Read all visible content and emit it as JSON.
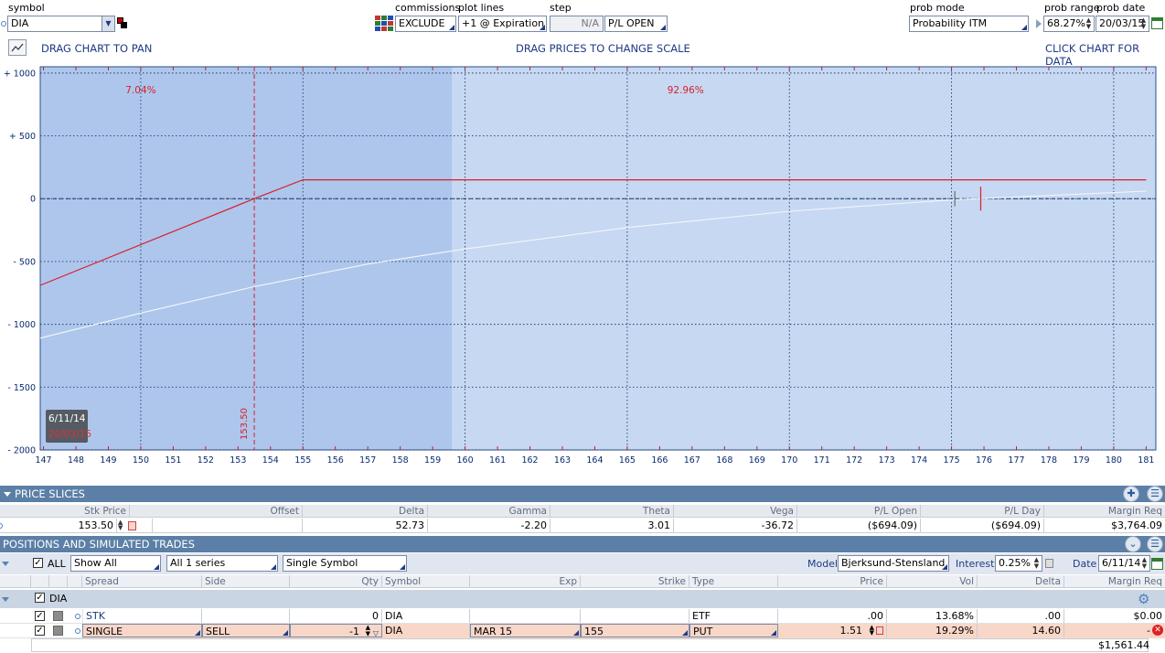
{
  "toolbar": {
    "symbol_label": "symbol",
    "symbol_value": "DIA",
    "commissions_label": "commissions",
    "commissions_value": "EXCLUDE",
    "plot_lines_label": "plot lines",
    "plot_lines_value": "+1 @ Expiration",
    "step_label": "step",
    "step_value": "N/A",
    "pl_mode_value": "P/L OPEN",
    "prob_mode_label": "prob mode",
    "prob_mode_value": "Probability ITM",
    "prob_range_label": "prob range",
    "prob_range_value": "68.27%",
    "prob_date_label": "prob date",
    "prob_date_value": "20/03/15"
  },
  "hints": {
    "pan": "DRAG CHART TO PAN",
    "scale": "DRAG PRICES TO CHANGE SCALE",
    "data": "CLICK CHART FOR DATA"
  },
  "chart_data": {
    "type": "line",
    "x_ticks": [
      "147",
      "148",
      "149",
      "150",
      "151",
      "152",
      "153",
      "154",
      "155",
      "156",
      "157",
      "158",
      "159",
      "160",
      "161",
      "162",
      "163",
      "164",
      "165",
      "166",
      "167",
      "168",
      "169",
      "170",
      "171",
      "172",
      "173",
      "174",
      "175",
      "176",
      "177",
      "178",
      "179",
      "180",
      "181"
    ],
    "y_ticks": [
      "+ 1000",
      "+ 500",
      "0",
      "- 500",
      "- 1000",
      "- 1500",
      "- 2000"
    ],
    "xlim": [
      146.9,
      181.3
    ],
    "ylim": [
      -2000,
      1050
    ],
    "prob_left": "7.04%",
    "prob_right": "92.96%",
    "shade_split_x": 159.6,
    "strike_line_x": 153.5,
    "strike_label": "153.50",
    "date_today": "6/11/14",
    "date_exp": "20/03/15",
    "series": [
      {
        "color": "#d8202a",
        "x": [
          146.9,
          153.5,
          155.0,
          181.0
        ],
        "y": [
          -690,
          0,
          150,
          150
        ]
      },
      {
        "color": "#f4f6fa",
        "x": [
          146.9,
          150,
          153.5,
          157,
          160,
          165,
          170,
          175,
          181
        ],
        "y": [
          -1110,
          -910,
          -700,
          -520,
          -400,
          -230,
          -100,
          -10,
          60
        ]
      }
    ]
  },
  "price_slices": {
    "title": "PRICE SLICES",
    "headers": [
      "Stk Price",
      "Offset",
      "Delta",
      "Gamma",
      "Theta",
      "Vega",
      "P/L Open",
      "P/L Day",
      "Margin Req"
    ],
    "row": [
      "153.50",
      "",
      "52.73",
      "-2.20",
      "3.01",
      "-36.72",
      "($694.09)",
      "($694.09)",
      "$3,764.09"
    ]
  },
  "positions": {
    "title": "POSITIONS AND SIMULATED TRADES",
    "all_label": "ALL",
    "show_value": "Show All",
    "series_value": "All 1 series",
    "symbol_mode_value": "Single Symbol",
    "model_label": "Model",
    "model_value": "Bjerksund-Stensland",
    "interest_label": "Interest",
    "interest_value": "0.25%",
    "date_label": "Date",
    "date_value": "6/11/14",
    "headers": [
      "Spread",
      "Side",
      "Qty",
      "Symbol",
      "Exp",
      "Strike",
      "Type",
      "Price",
      "Vol",
      "Delta",
      "Margin Req"
    ],
    "group_label": "DIA",
    "rows": [
      {
        "spread": "STK",
        "side": "",
        "qty": "0",
        "symbol": "DIA",
        "exp": "",
        "strike": "",
        "type": "ETF",
        "price": ".00",
        "vol": "13.68%",
        "delta": ".00",
        "margin": "$0.00"
      },
      {
        "spread": "SINGLE",
        "side": "SELL",
        "qty": "-1",
        "symbol": "DIA",
        "exp": "MAR 15",
        "strike": "155",
        "type": "PUT",
        "price": "1.51",
        "vol": "19.29%",
        "delta": "14.60",
        "margin": "-"
      }
    ],
    "total_margin": "$1,561.44"
  }
}
